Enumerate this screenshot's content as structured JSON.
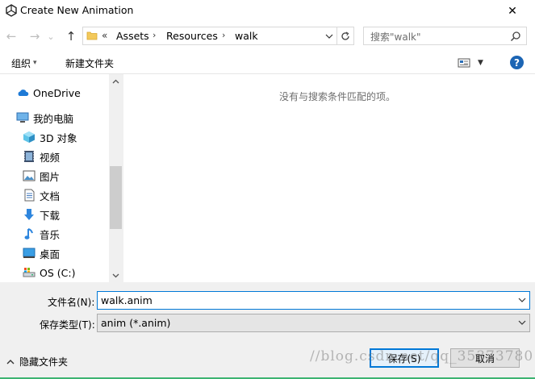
{
  "window": {
    "title": "Create New Animation",
    "close_glyph": "✕"
  },
  "navigation": {
    "back_glyph": "←",
    "forward_glyph": "→",
    "recent_glyph": "⌄",
    "up_glyph": "↑",
    "breadcrumb_overflow": "«",
    "breadcrumbs": [
      "Assets",
      "Resources",
      "walk"
    ],
    "separator": "›",
    "search_placeholder": "搜索\"walk\""
  },
  "toolbar": {
    "organize_label": "组织",
    "new_folder_label": "新建文件夹",
    "help_label": "?"
  },
  "sidebar": {
    "items": [
      {
        "label": "OneDrive",
        "icon": "cloud-icon"
      },
      {
        "label": "我的电脑",
        "icon": "computer-icon"
      },
      {
        "label": "3D 对象",
        "icon": "cube-icon"
      },
      {
        "label": "视频",
        "icon": "video-icon"
      },
      {
        "label": "图片",
        "icon": "picture-icon"
      },
      {
        "label": "文档",
        "icon": "document-icon"
      },
      {
        "label": "下载",
        "icon": "download-icon"
      },
      {
        "label": "音乐",
        "icon": "music-icon"
      },
      {
        "label": "桌面",
        "icon": "desktop-icon"
      },
      {
        "label": "OS (C:)",
        "icon": "drive-icon"
      }
    ]
  },
  "content": {
    "empty_message": "没有与搜索条件匹配的项。"
  },
  "form": {
    "filename_label": "文件名(N):",
    "filename_value": "walk.anim",
    "filetype_label": "保存类型(T):",
    "filetype_value": "anim (*.anim)"
  },
  "footer": {
    "hide_folders_label": "隐藏文件夹",
    "save_label": "保存(S)",
    "cancel_label": "取消",
    "watermark": "//blog.csdn.net/qq_35373780"
  },
  "colors": {
    "accent": "#0078d7",
    "help": "#1c65b4",
    "onedrive": "#1e7ad6",
    "folder": "#f3c95b"
  }
}
